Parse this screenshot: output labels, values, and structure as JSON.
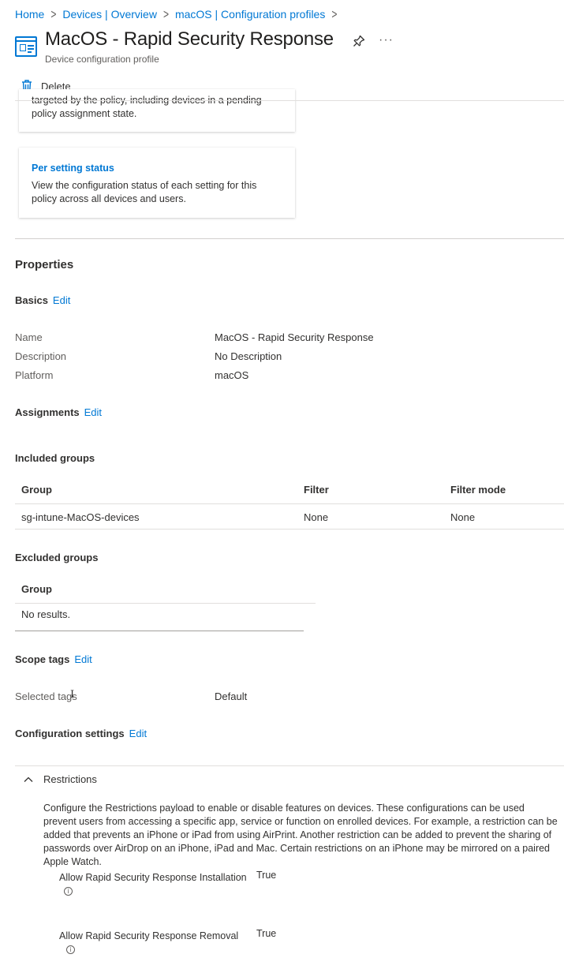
{
  "breadcrumb": {
    "items": [
      "Home",
      "Devices | Overview",
      "macOS | Configuration profiles"
    ],
    "separator": ">"
  },
  "header": {
    "title": "MacOS - Rapid Security Response",
    "subtitle": "Device configuration profile",
    "more_label": "···"
  },
  "toolbar": {
    "delete_label": "Delete"
  },
  "cards": [
    {
      "text": "targeted by the policy, including devices in a pending policy assignment state."
    },
    {
      "title": "Per setting status",
      "text": "View the configuration status of each setting for this policy across all devices and users."
    }
  ],
  "properties": {
    "heading": "Properties",
    "edit_label": "Edit",
    "basics": {
      "heading": "Basics",
      "rows": [
        {
          "label": "Name",
          "value": "MacOS - Rapid Security Response"
        },
        {
          "label": "Description",
          "value": "No Description"
        },
        {
          "label": "Platform",
          "value": "macOS"
        }
      ]
    },
    "assignments": {
      "heading": "Assignments",
      "included": {
        "heading": "Included groups",
        "columns": [
          "Group",
          "Filter",
          "Filter mode"
        ],
        "rows": [
          [
            "sg-intune-MacOS-devices",
            "None",
            "None"
          ]
        ]
      },
      "excluded": {
        "heading": "Excluded groups",
        "columns": [
          "Group"
        ],
        "empty_text": "No results."
      }
    },
    "scope_tags": {
      "heading": "Scope tags",
      "label": "Selected tags",
      "value": "Default"
    },
    "configuration_settings": {
      "heading": "Configuration settings",
      "category": "Restrictions",
      "description": "Configure the Restrictions payload to enable or disable features on devices. These configurations can be used prevent users from accessing a specific app, service or function on enrolled devices. For example, a restriction can be added that prevents an iPhone or iPad from using AirPrint. Another restriction can be added to prevent the sharing of passwords over AirDrop on an iPhone, iPad and Mac. Certain restrictions on an iPhone may be mirrored on a paired Apple Watch.",
      "settings": [
        {
          "label": "Allow Rapid Security Response Installation",
          "value": "True"
        },
        {
          "label": "Allow Rapid Security Response Removal",
          "value": "True"
        }
      ]
    }
  },
  "colors": {
    "accent": "#0078d4",
    "text": "#323130",
    "muted": "#605e5c",
    "divider": "#e1dfdd"
  },
  "icons": [
    "configuration-profile-icon",
    "pin-icon",
    "more-icon",
    "trash-icon",
    "chevron-up-icon",
    "info-icon"
  ]
}
